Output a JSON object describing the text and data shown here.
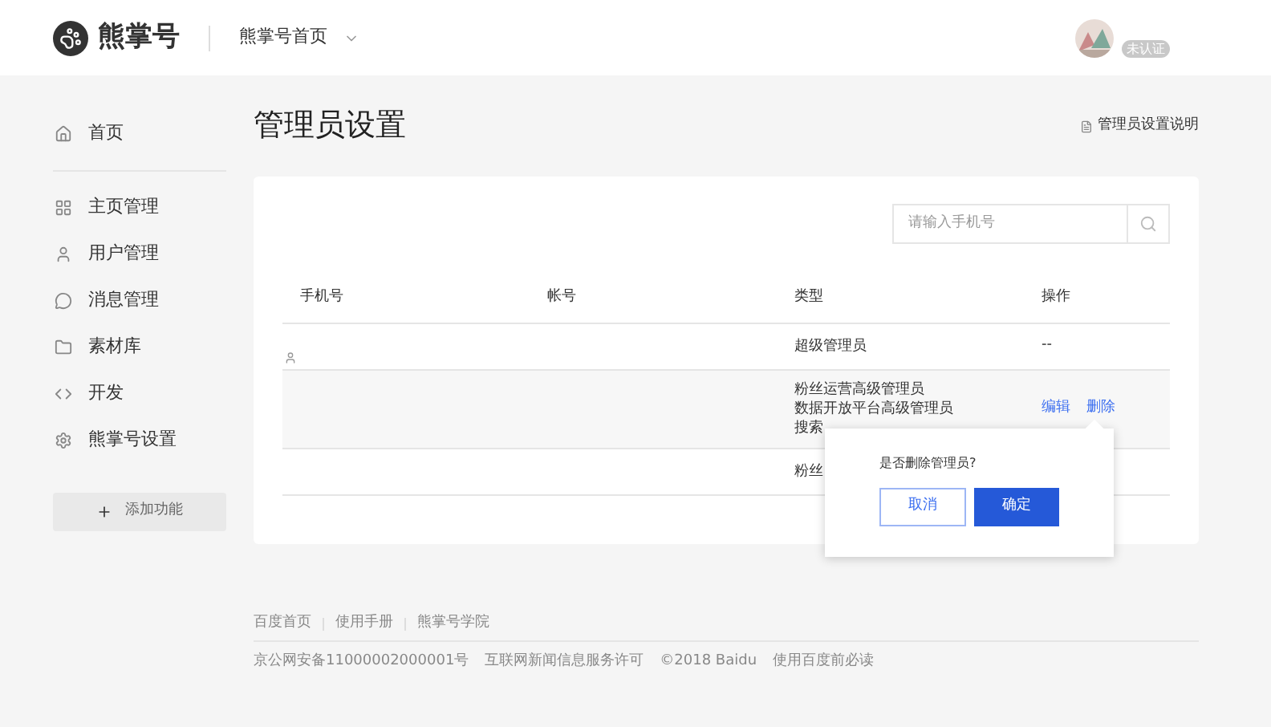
{
  "header": {
    "logo": "熊掌号",
    "nav": "熊掌号首页",
    "badge": "未认证"
  },
  "sidebar": {
    "items": [
      {
        "label": "首页",
        "selected": false
      },
      {
        "label": "主页管理",
        "selected": false
      },
      {
        "label": "用户管理",
        "selected": false
      },
      {
        "label": "消息管理",
        "selected": false
      },
      {
        "label": "素材库",
        "selected": false
      },
      {
        "label": "开发",
        "selected": false
      },
      {
        "label": "熊掌号设置",
        "selected": false
      }
    ],
    "add_button": "添加功能"
  },
  "page": {
    "title": "管理员设置",
    "help_link": "管理员设置说明"
  },
  "search": {
    "placeholder": "请输入手机号"
  },
  "table": {
    "columns": [
      "手机号",
      "帐号",
      "类型",
      "操作"
    ],
    "rows": [
      {
        "avatar": true,
        "types": [
          "超级管理员"
        ],
        "actions": [
          "--"
        ],
        "hovered": false
      },
      {
        "avatar": false,
        "types": [
          "粉丝运营高级管理员",
          "数据开放平台高级管理员",
          "搜索"
        ],
        "actions": [
          "编辑",
          "删除"
        ],
        "hovered": true
      },
      {
        "avatar": false,
        "types": [
          "粉丝"
        ],
        "actions": [],
        "hovered": false
      }
    ]
  },
  "popover": {
    "message": "是否删除管理员?",
    "cancel": "取消",
    "confirm": "确定"
  },
  "footer": {
    "links": [
      "百度首页",
      "使用手册",
      "熊掌号学院"
    ],
    "legal": [
      "京公网安备11000002000001号",
      "互联网新闻信息服务许可",
      "©2018 Baidu",
      "使用百度前必读"
    ]
  }
}
